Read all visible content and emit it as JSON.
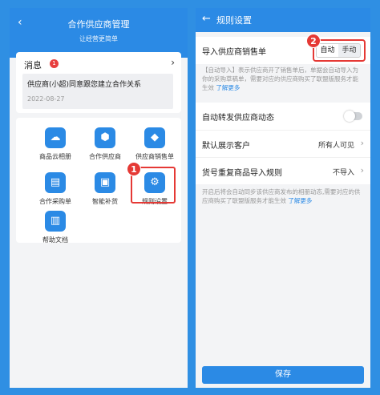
{
  "left": {
    "header": {
      "back_glyph": "‹",
      "title": "合作供应商管理",
      "subtitle": "让经营更简单"
    },
    "messages": {
      "title": "消息",
      "badge": "1",
      "item_text": "供应商(小超)同意跟您建立合作关系",
      "item_date": "2022-08-27"
    },
    "tiles": [
      {
        "label": "商品云相册",
        "icon": "cloud-icon"
      },
      {
        "label": "合作供应商",
        "icon": "supplier-icon"
      },
      {
        "label": "供应商销售单",
        "icon": "tag-icon"
      },
      {
        "label": "合作采购单",
        "icon": "purchase-icon"
      },
      {
        "label": "智能补货",
        "icon": "box-icon"
      },
      {
        "label": "规则设置",
        "icon": "gear-icon"
      },
      {
        "label": "帮助文档",
        "icon": "book-icon"
      }
    ],
    "marker": "1"
  },
  "right": {
    "header": {
      "back_glyph": "←",
      "title": "规则设置"
    },
    "import_row": {
      "label": "导入供应商销售单",
      "option_auto": "自动",
      "option_manual": "手动",
      "selected": "自动"
    },
    "marker": "2",
    "import_note": "【自动导入】表示供应商开了销售单后，单据会自动导入为你的采购草稿单，需要对应的供应商购买了联盟版服务才能生效",
    "import_note_link": "了解更多",
    "forward_row": {
      "label": "自动转发供应商动态",
      "toggle_on": false
    },
    "customer_row": {
      "label": "默认展示客户",
      "value": "所有人可见"
    },
    "dup_row": {
      "label": "货号重复商品导入规则",
      "value": "不导入"
    },
    "forward_note": "开启后将会自动同步该供应商发布的相册动态,需要对应的供应商购买了联盟版服务才能生效",
    "forward_note_link": "了解更多",
    "save_label": "保存"
  },
  "colors": {
    "accent": "#2b8ae5",
    "marker": "#e53935",
    "background": "#2f8fe3"
  }
}
